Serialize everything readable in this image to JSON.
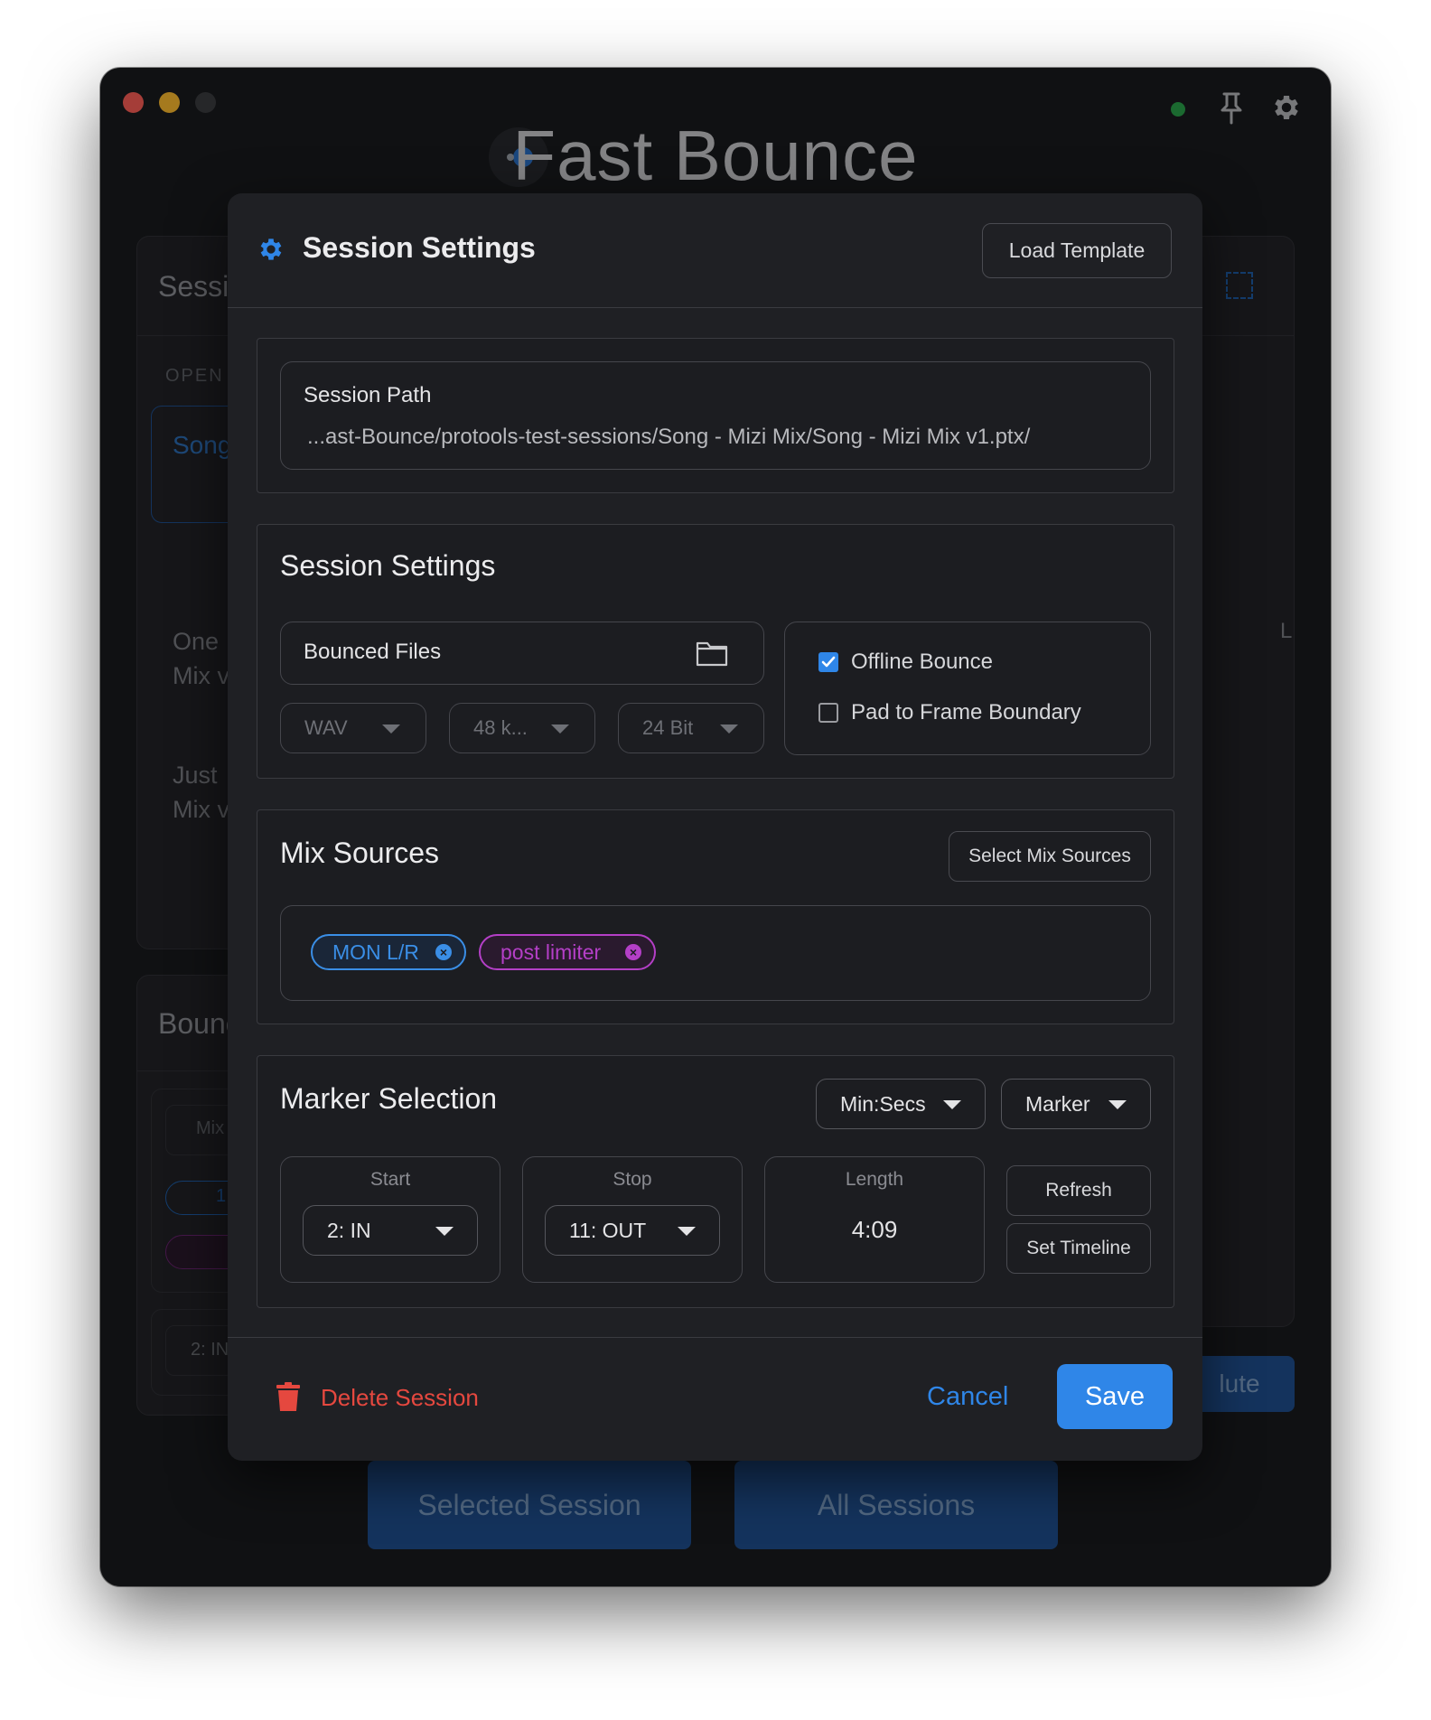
{
  "app": {
    "title": "Fast Bounce"
  },
  "background": {
    "panel_title_1": "Sessi",
    "open_label": "OPEN",
    "song_item": "Song",
    "item_one_line1": "One",
    "item_one_line2": "Mix v",
    "item_just_line1": "Just",
    "item_just_line2": "Mix v",
    "right_fragment": "L",
    "panel_title_2": "Bounc",
    "mix_fragment": "Mix",
    "chip_fragment": "1",
    "in_fragment": "2: IN",
    "mute_fragment": "lute",
    "selected_session_button": "Selected Session",
    "all_sessions_button": "All Sessions"
  },
  "modal": {
    "title": "Session Settings",
    "load_template_button": "Load Template",
    "session_path": {
      "label": "Session Path",
      "value": "...ast-Bounce/protools-test-sessions/Song - Mizi Mix/Song - Mizi Mix v1.ptx/"
    },
    "session_settings": {
      "title": "Session Settings",
      "bounced_files_label": "Bounced Files",
      "format_select": "WAV",
      "sample_rate_select": "48 k...",
      "bit_depth_select": "24 Bit",
      "offline_bounce_label": "Offline Bounce",
      "offline_bounce_checked": true,
      "pad_frame_label": "Pad to Frame Boundary",
      "pad_frame_checked": false
    },
    "mix_sources": {
      "title": "Mix Sources",
      "select_button": "Select Mix Sources",
      "chips": [
        {
          "label": "MON L/R",
          "color": "#3a8ee6"
        },
        {
          "label": "post limiter",
          "color": "#b43fc7"
        }
      ]
    },
    "marker_selection": {
      "title": "Marker Selection",
      "time_format_select": "Min:Secs",
      "marker_type_select": "Marker",
      "start_label": "Start",
      "start_value": "2: IN",
      "stop_label": "Stop",
      "stop_value": "11: OUT",
      "length_label": "Length",
      "length_value": "4:09",
      "refresh_button": "Refresh",
      "set_timeline_button": "Set Timeline"
    },
    "footer": {
      "delete_label": "Delete Session",
      "cancel_label": "Cancel",
      "save_label": "Save"
    }
  },
  "colors": {
    "accent": "#2f86e8",
    "danger": "#e5483f",
    "chip_blue": "#3a8ee6",
    "chip_purple": "#b43fc7"
  }
}
